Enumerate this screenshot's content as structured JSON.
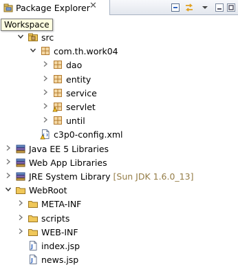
{
  "view": {
    "title": "Package Explorer",
    "close_glyph": "✕",
    "tooltip": "Workspace"
  },
  "toolbar": [
    {
      "icon": "collapse-all-icon"
    },
    {
      "icon": "link-with-editor-icon"
    },
    {
      "icon": "view-menu-icon"
    },
    {
      "icon": "minimize-icon"
    },
    {
      "icon": "maximize-icon"
    }
  ],
  "tree": [
    {
      "label": "src",
      "level": 1,
      "state": "expanded",
      "icon": "source-folder-icon"
    },
    {
      "label": "com.th.work04",
      "level": 2,
      "state": "expanded",
      "icon": "package-icon"
    },
    {
      "label": "dao",
      "level": 3,
      "state": "collapsed",
      "icon": "package-icon"
    },
    {
      "label": "entity",
      "level": 3,
      "state": "collapsed",
      "icon": "package-icon"
    },
    {
      "label": "service",
      "level": 3,
      "state": "collapsed",
      "icon": "package-icon"
    },
    {
      "label": "servlet",
      "level": 3,
      "state": "collapsed",
      "icon": "package-warning-icon"
    },
    {
      "label": "until",
      "level": 3,
      "state": "collapsed",
      "icon": "package-icon"
    },
    {
      "label": "c3p0-config.xml",
      "level": 2,
      "state": "leaf",
      "icon": "xml-file-warning-icon"
    },
    {
      "label": "Java EE 5 Libraries",
      "level": 0,
      "state": "collapsed",
      "icon": "library-icon"
    },
    {
      "label": "Web App Libraries",
      "level": 0,
      "state": "collapsed",
      "icon": "library-icon"
    },
    {
      "label": "JRE System Library",
      "decoration": "[Sun JDK 1.6.0_13]",
      "level": 0,
      "state": "collapsed",
      "icon": "library-icon"
    },
    {
      "label": "WebRoot",
      "level": 0,
      "state": "expanded",
      "icon": "folder-icon"
    },
    {
      "label": "META-INF",
      "level": 1,
      "state": "collapsed",
      "icon": "folder-icon"
    },
    {
      "label": "scripts",
      "level": 1,
      "state": "collapsed",
      "icon": "folder-icon"
    },
    {
      "label": "WEB-INF",
      "level": 1,
      "state": "collapsed",
      "icon": "folder-icon"
    },
    {
      "label": "index.jsp",
      "level": 1,
      "state": "leaf",
      "icon": "jsp-file-icon"
    },
    {
      "label": "news.jsp",
      "level": 1,
      "state": "leaf",
      "icon": "jsp-file-icon"
    }
  ]
}
